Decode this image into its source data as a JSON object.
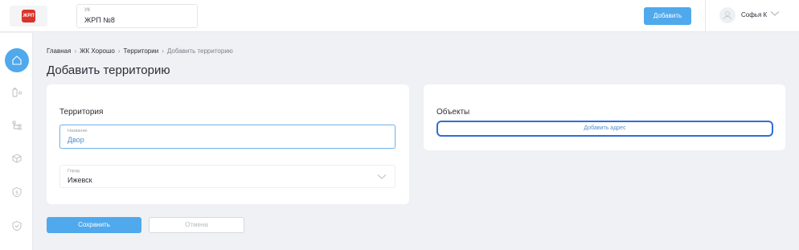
{
  "header": {
    "logo_text": "ЖРП",
    "uk_label": "УК",
    "uk_value": "ЖРП №8",
    "add_button": "Добавить",
    "user_name": "Софья К"
  },
  "sidebar": {
    "items": [
      {
        "icon": "home-icon",
        "active": true
      },
      {
        "icon": "meter-icon",
        "active": false
      },
      {
        "icon": "hierarchy-icon",
        "active": false
      },
      {
        "icon": "box-icon",
        "active": false
      },
      {
        "icon": "shield-icon",
        "active": false
      },
      {
        "icon": "shield-check-icon",
        "active": false
      }
    ]
  },
  "breadcrumb": {
    "items": [
      "Главная",
      "ЖК Хорошо",
      "Территории"
    ],
    "current": "Добавить территорию"
  },
  "page_title": "Добавить территорию",
  "territory_card": {
    "title": "Территория",
    "name_label": "Название",
    "name_value": "Двор",
    "city_label": "Город",
    "city_value": "Ижевск"
  },
  "objects_card": {
    "title": "Объекты",
    "add_address_button": "Добавить адрес"
  },
  "actions": {
    "save": "Сохранить",
    "cancel": "Отмена"
  },
  "colors": {
    "accent": "#4fa9ec",
    "logo_red": "#d9342b",
    "focus_border": "#2e6fd6"
  }
}
